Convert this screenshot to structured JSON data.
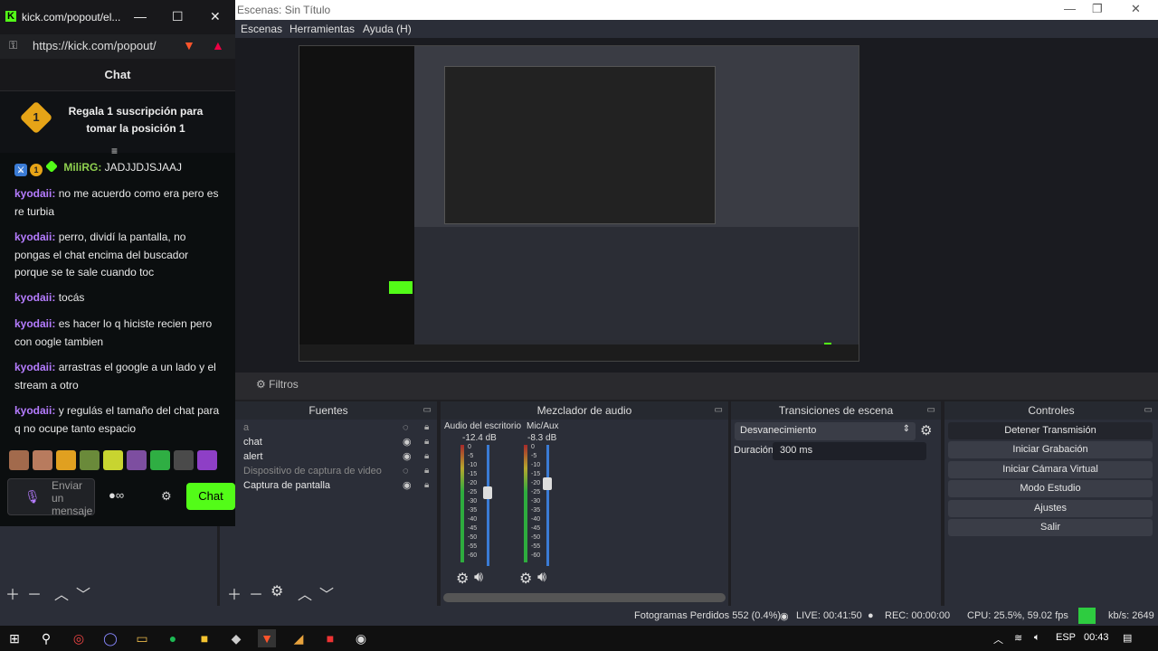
{
  "obs": {
    "window_title": "Escenas: Sin Título",
    "window_controls": [
      "—",
      "❐",
      "✕"
    ],
    "menu": [
      "Escenas",
      "Herramientas",
      "Ayuda (H)"
    ],
    "filters_tab": "Filtros",
    "sources": {
      "title": "Fuentes",
      "items": [
        {
          "name": "a",
          "visible": false
        },
        {
          "name": "chat",
          "visible": true
        },
        {
          "name": "alert",
          "visible": true
        },
        {
          "name": "Dispositivo de captura de video",
          "visible": false
        },
        {
          "name": "Captura de pantalla",
          "visible": true
        }
      ]
    },
    "mixer": {
      "title": "Mezclador de audio",
      "channels": [
        {
          "name": "Audio del escritorio",
          "db": "-12.4 dB",
          "level": 0.55
        },
        {
          "name": "Mic/Aux",
          "db": "-8.3 dB",
          "level": 0.65
        }
      ],
      "scale": [
        "0",
        "-5",
        "-10",
        "-15",
        "-20",
        "-25",
        "-30",
        "-35",
        "-40",
        "-45",
        "-50",
        "-55",
        "-60"
      ]
    },
    "transitions": {
      "title": "Transiciones de escena",
      "selected": "Desvanecimiento",
      "duration_label": "Duración",
      "duration_value": "300 ms"
    },
    "controls": {
      "title": "Controles",
      "buttons": [
        "Detener Transmisión",
        "Iniciar Grabación",
        "Iniciar Cámara Virtual",
        "Modo Estudio",
        "Ajustes",
        "Salir"
      ]
    },
    "status": {
      "frames": "Fotogramas Perdidos 552 (0.4%)",
      "live": "LIVE: 00:41:50",
      "rec": "REC: 00:00:00",
      "cpu": "CPU: 25.5%, 59.02 fps",
      "kbps": "kb/s: 2649"
    },
    "colors": {
      "accent_green": "#53fc18",
      "status_green": "#2ecc40",
      "panel": "#2b2e38"
    }
  },
  "kick": {
    "tab_title": "kick.com/popout/el...",
    "url": "https://kick.com/popout/",
    "chat_title": "Chat",
    "pinned_rank": "1",
    "pinned_text": "Regala 1 suscripción para tomar la posición 1",
    "first_line": {
      "user": "MiliRG:",
      "text": " JADJJDJSJAAJ"
    },
    "messages": [
      {
        "user": "kyodaii:",
        "text": " no me acuerdo como era pero es re turbia"
      },
      {
        "user": "kyodaii:",
        "text": " perro, dividí la pantalla, no pongas el chat encima del buscador porque se te sale cuando toc"
      },
      {
        "user": "kyodaii:",
        "text": " tocás"
      },
      {
        "user": "kyodaii:",
        "text": " es hacer lo q hiciste recien pero con oogle tambien"
      },
      {
        "user": "kyodaii:",
        "text": " arrastras el google a un lado y el stream a otro"
      },
      {
        "user": "kyodaii:",
        "text": " y regulás el tamaño del chat para q no ocupe tanto espacio"
      }
    ],
    "input_placeholder": "Enviar un mensaje",
    "chat_button": "Chat"
  },
  "taskbar": {
    "lang": "ESP",
    "time": "00:43"
  }
}
